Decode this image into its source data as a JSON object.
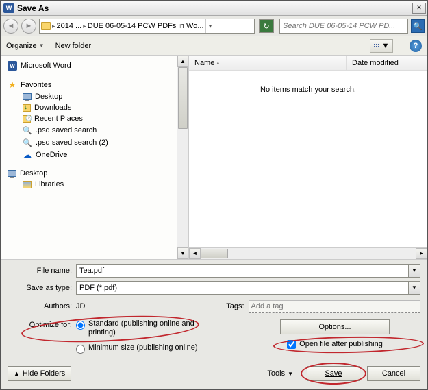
{
  "titlebar": {
    "title": "Save As",
    "icon_label": "W"
  },
  "nav": {
    "path_parts": [
      "2014 ...",
      "DUE 06-05-14 PCW PDFs in Wo..."
    ],
    "search_placeholder": "Search DUE 06-05-14 PCW PD..."
  },
  "toolbar": {
    "organize": "Organize",
    "newfolder": "New folder",
    "help": "?"
  },
  "tree": {
    "word": "Microsoft Word",
    "fav": "Favorites",
    "fav_items": [
      "Desktop",
      "Downloads",
      "Recent Places",
      ".psd saved search",
      ".psd saved search (2)",
      "OneDrive"
    ],
    "desktop": "Desktop",
    "libraries": "Libraries"
  },
  "list": {
    "col_name": "Name",
    "col_date": "Date modified",
    "empty": "No items match your search."
  },
  "form": {
    "filename_label": "File name:",
    "filename_value": "Tea.pdf",
    "saveastype_label": "Save as type:",
    "saveastype_value": "PDF (*.pdf)",
    "authors_label": "Authors:",
    "authors_value": "JD",
    "tags_label": "Tags:",
    "tags_placeholder": "Add a tag",
    "optimize_label": "Optimize for:",
    "opt_standard": "Standard (publishing online and printing)",
    "opt_min": "Minimum size (publishing online)",
    "options_btn": "Options...",
    "open_after": "Open file after publishing"
  },
  "footer": {
    "hide": "Hide Folders",
    "tools": "Tools",
    "save": "Save",
    "cancel": "Cancel"
  }
}
